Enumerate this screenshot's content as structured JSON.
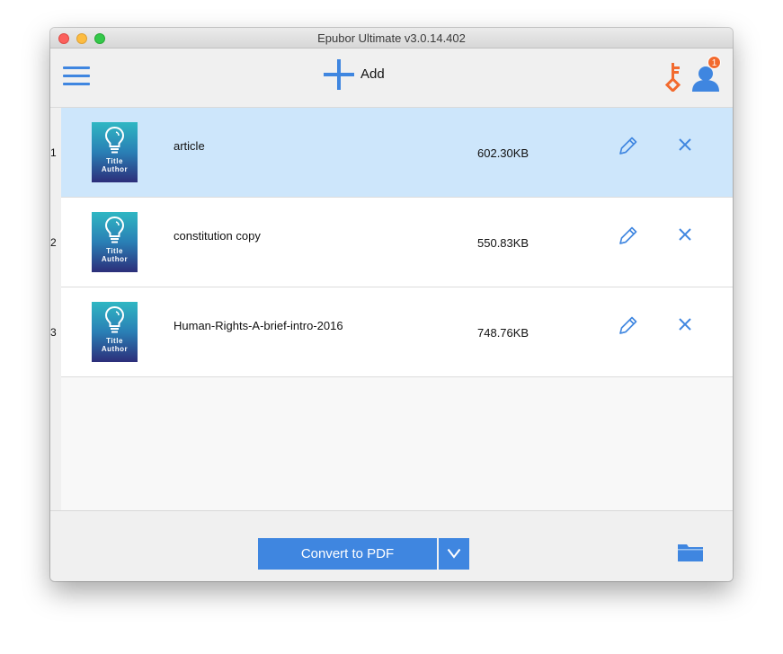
{
  "window": {
    "title": "Epubor Ultimate v3.0.14.402"
  },
  "toolbar": {
    "menu_icon": "hamburger-menu-icon",
    "add_label": "Add",
    "add_icon": "plus-icon",
    "key_icon": "key-icon",
    "user_icon": "user-icon",
    "notification_count": "1"
  },
  "colors": {
    "accent_blue": "#3f86e0",
    "selected_row": "#cde6fb",
    "key_orange": "#f26a2e",
    "badge_orange": "#f26a2e"
  },
  "files": [
    {
      "index": "1",
      "cover_title": "Title",
      "cover_author": "Author",
      "name": "article",
      "size": "602.30KB",
      "selected": true
    },
    {
      "index": "2",
      "cover_title": "Title",
      "cover_author": "Author",
      "name": "constitution copy",
      "size": "550.83KB",
      "selected": false
    },
    {
      "index": "3",
      "cover_title": "Title",
      "cover_author": "Author",
      "name": "Human-Rights-A-brief-intro-2016",
      "size": "748.76KB",
      "selected": false
    }
  ],
  "bottom": {
    "convert_label": "Convert to PDF",
    "dropdown_icon": "chevron-down-icon",
    "folder_icon": "folder-icon"
  }
}
